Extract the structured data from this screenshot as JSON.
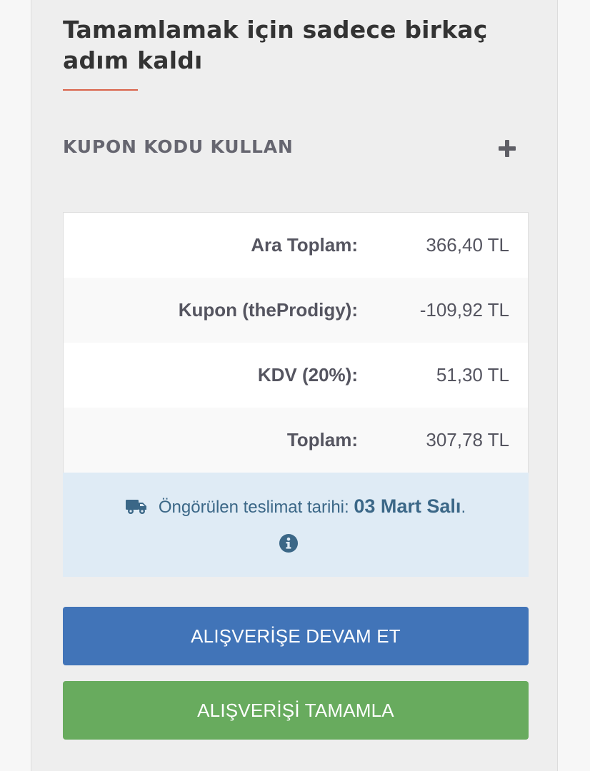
{
  "header": {
    "title": "Tamamlamak için sadece birkaç adım kaldı"
  },
  "coupon": {
    "label": "KUPON KODU KULLAN",
    "toggle_icon": "plus-icon"
  },
  "totals": [
    {
      "label": "Ara Toplam:",
      "value": "366,40 TL"
    },
    {
      "label": "Kupon (theProdigy):",
      "value": "-109,92 TL"
    },
    {
      "label": "KDV (20%):",
      "value": "51,30 TL"
    },
    {
      "label": "Toplam:",
      "value": "307,78 TL"
    }
  ],
  "delivery": {
    "icon": "truck-icon",
    "text": "Öngörülen teslimat tarihi:",
    "date": "03 Mart Salı",
    "suffix": ".",
    "info_icon": "info-icon"
  },
  "buttons": {
    "continue_label": "ALIŞVERİŞE DEVAM ET",
    "complete_label": "ALIŞVERİŞİ TAMAMLA"
  },
  "colors": {
    "accent_underline": "#d9634a",
    "continue_button": "#4174b8",
    "complete_button": "#68ab5e",
    "delivery_background": "#dfebf5",
    "delivery_text": "#3b6787"
  }
}
